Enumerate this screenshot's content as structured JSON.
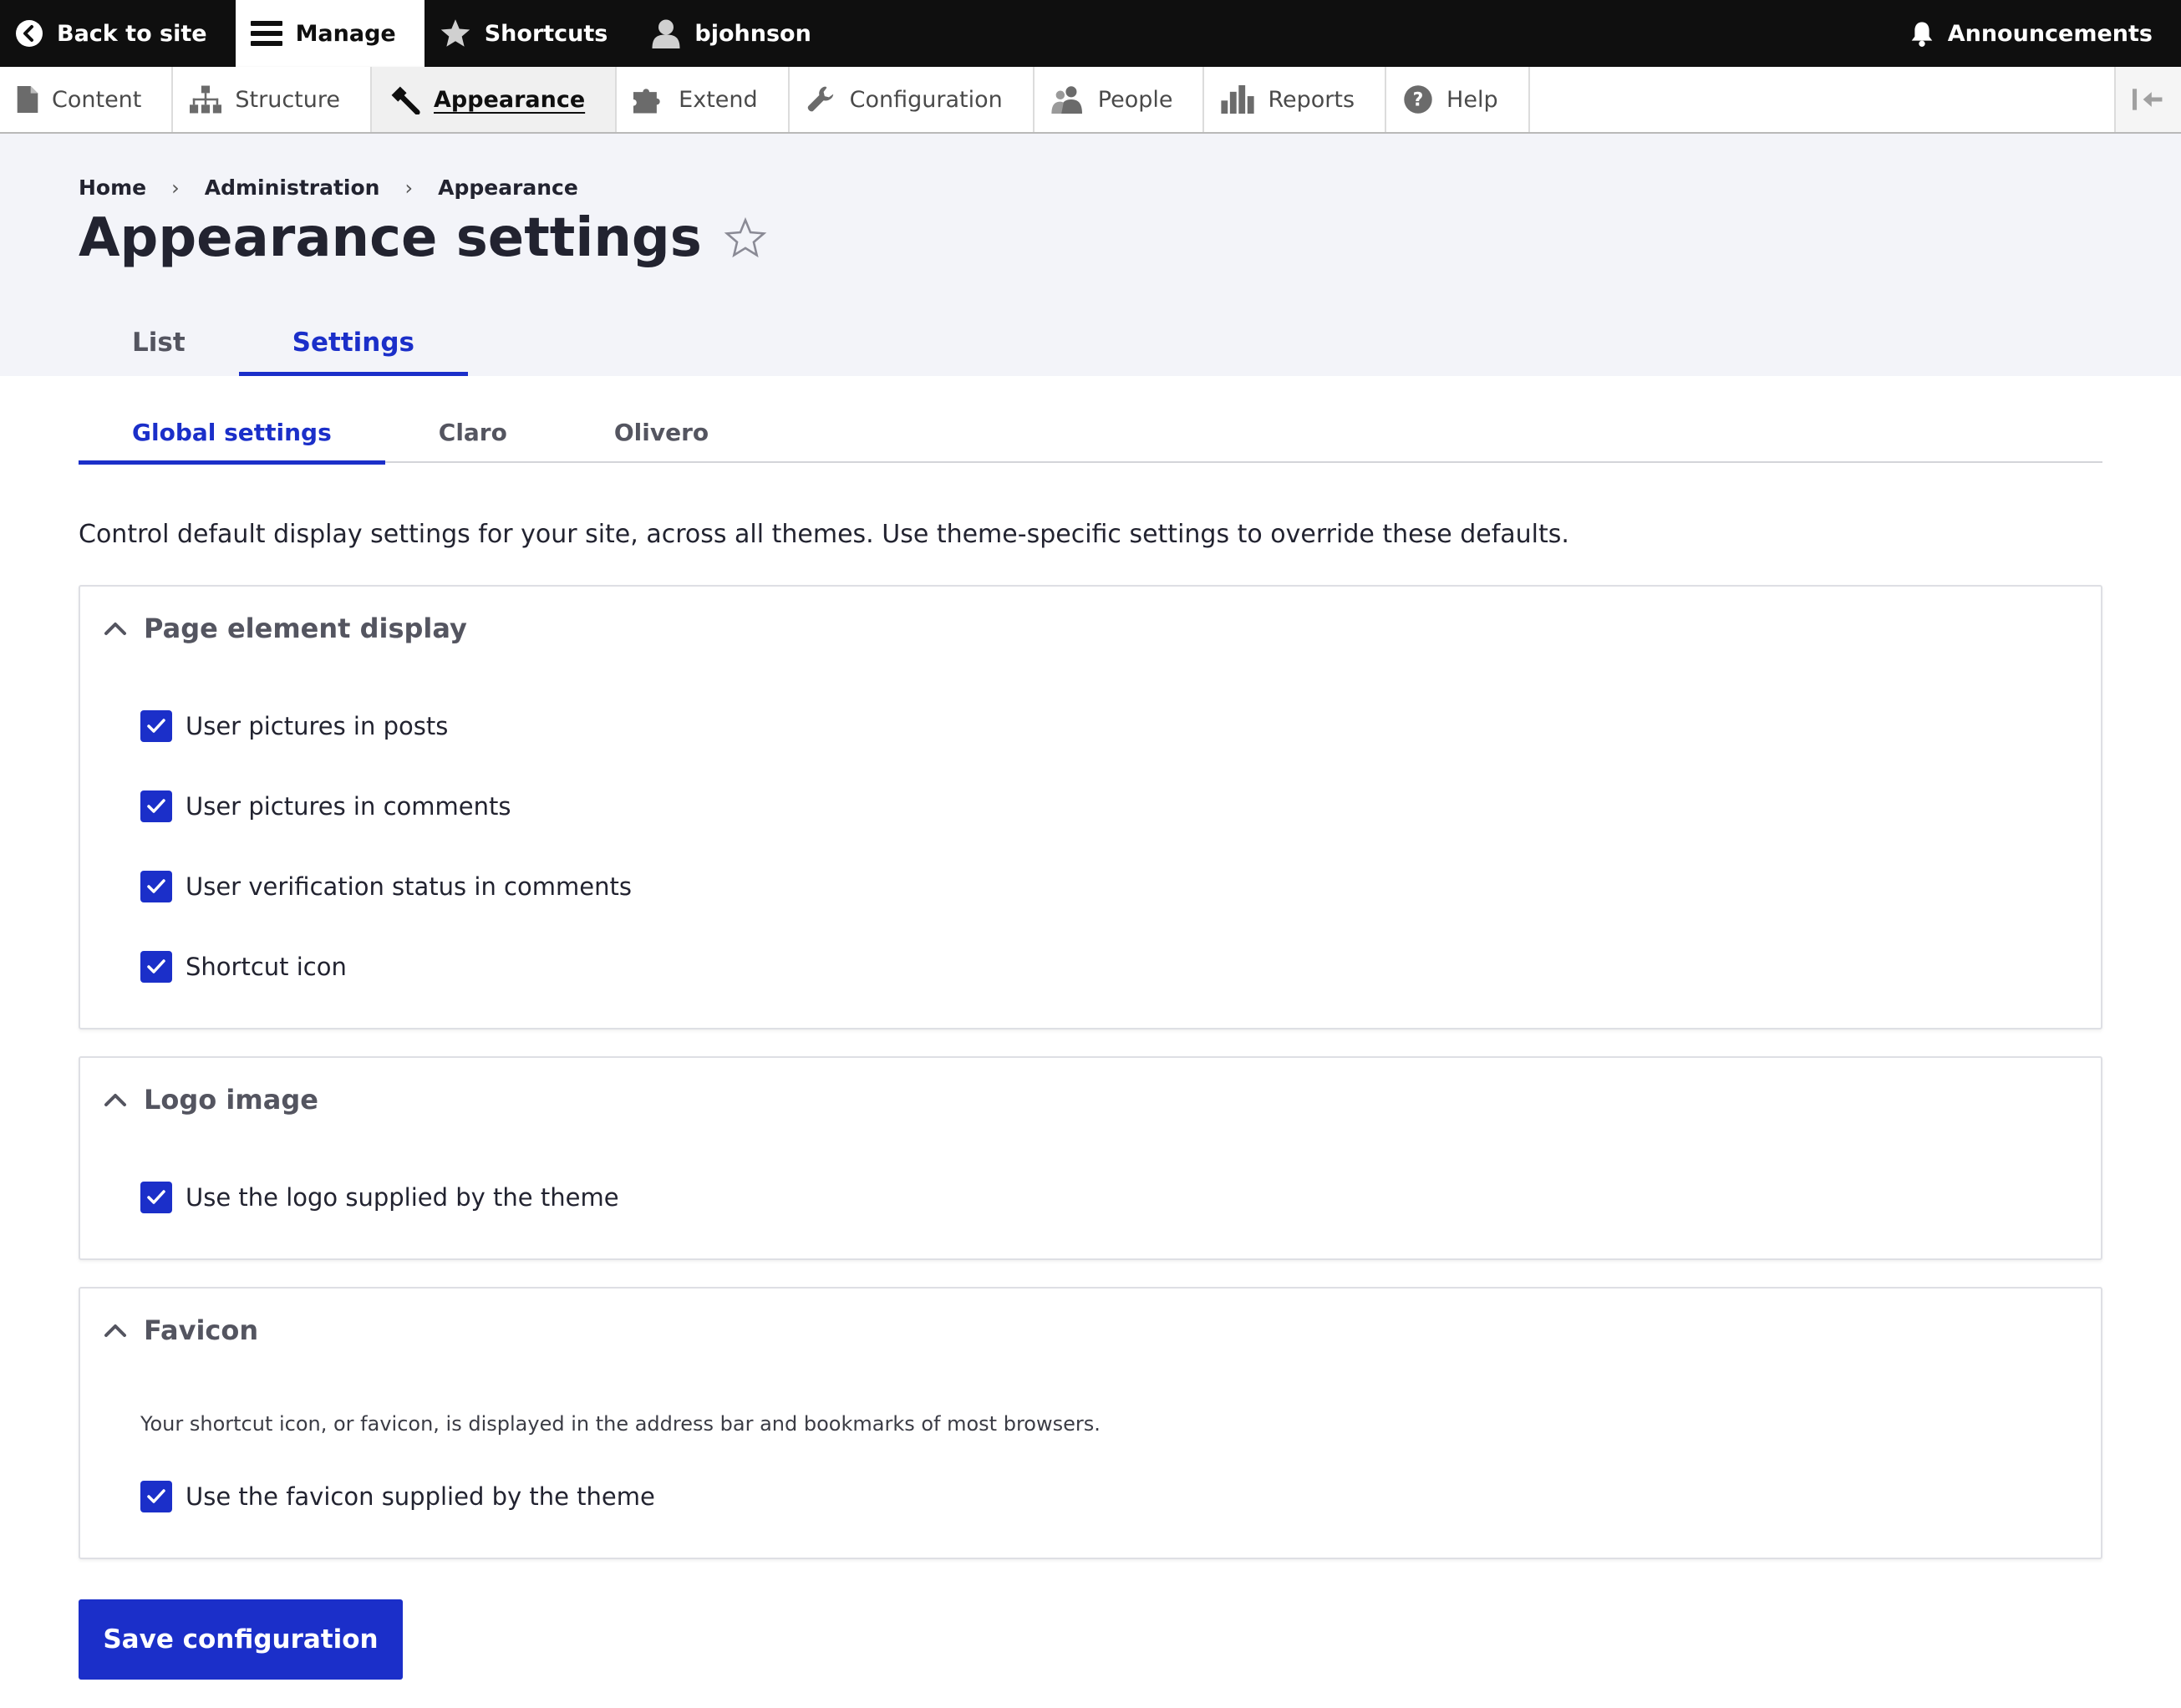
{
  "toolbar": {
    "back_label": "Back to site",
    "manage_label": "Manage",
    "shortcuts_label": "Shortcuts",
    "user_label": "bjohnson",
    "announcements_label": "Announcements"
  },
  "tray": {
    "items": [
      {
        "label": "Content",
        "icon": "file-icon"
      },
      {
        "label": "Structure",
        "icon": "sitemap-icon"
      },
      {
        "label": "Appearance",
        "icon": "paint-brush-icon"
      },
      {
        "label": "Extend",
        "icon": "puzzle-icon"
      },
      {
        "label": "Configuration",
        "icon": "wrench-icon"
      },
      {
        "label": "People",
        "icon": "people-icon"
      },
      {
        "label": "Reports",
        "icon": "bar-chart-icon"
      },
      {
        "label": "Help",
        "icon": "help-icon"
      }
    ],
    "active": "Appearance"
  },
  "breadcrumb": {
    "items": [
      "Home",
      "Administration",
      "Appearance"
    ],
    "separator": "›"
  },
  "page": {
    "title": "Appearance settings"
  },
  "primary_tabs": [
    {
      "label": "List",
      "active": false
    },
    {
      "label": "Settings",
      "active": true
    }
  ],
  "secondary_tabs": [
    {
      "label": "Global settings",
      "active": true
    },
    {
      "label": "Claro",
      "active": false
    },
    {
      "label": "Olivero",
      "active": false
    }
  ],
  "intro_text": "Control default display settings for your site, across all themes. Use theme-specific settings to override these defaults.",
  "panels": {
    "page_element_display": {
      "title": "Page element display",
      "checkboxes": [
        {
          "label": "User pictures in posts",
          "checked": true
        },
        {
          "label": "User pictures in comments",
          "checked": true
        },
        {
          "label": "User verification status in comments",
          "checked": true
        },
        {
          "label": "Shortcut icon",
          "checked": true
        }
      ]
    },
    "logo_image": {
      "title": "Logo image",
      "checkboxes": [
        {
          "label": "Use the logo supplied by the theme",
          "checked": true
        }
      ]
    },
    "favicon": {
      "title": "Favicon",
      "description": "Your shortcut icon, or favicon, is displayed in the address bar and bookmarks of most browsers.",
      "checkboxes": [
        {
          "label": "Use the favicon supplied by the theme",
          "checked": true
        }
      ]
    }
  },
  "actions": {
    "save_label": "Save configuration"
  },
  "colors": {
    "accent": "#1b2fc9",
    "toolbar_bg": "#0f0f0f",
    "header_bg": "#f3f4f9"
  }
}
